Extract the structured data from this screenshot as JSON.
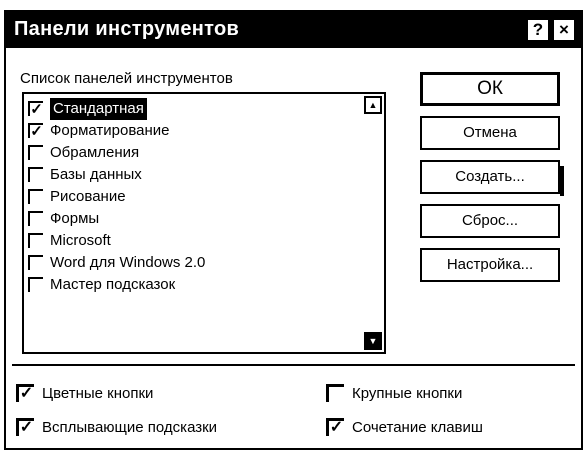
{
  "dialog": {
    "title": "Панели инструментов",
    "help_glyph": "?",
    "close_glyph": "×"
  },
  "toolbars": {
    "label": "Список панелей инструментов",
    "items": [
      {
        "label": "Стандартная",
        "checked": true
      },
      {
        "label": "Форматирование",
        "checked": true
      },
      {
        "label": "Обрамления",
        "checked": false
      },
      {
        "label": "Базы данных",
        "checked": false
      },
      {
        "label": "Рисование",
        "checked": false
      },
      {
        "label": "Формы",
        "checked": false
      },
      {
        "label": "Microsoft",
        "checked": false
      },
      {
        "label": "Word для Windows 2.0",
        "checked": false
      },
      {
        "label": "Мастер подсказок",
        "checked": false
      }
    ]
  },
  "buttons": {
    "ok": "ОК",
    "cancel": "Отмена",
    "create": "Создать...",
    "reset": "Сброс...",
    "settings": "Настройка..."
  },
  "options": {
    "color_buttons": {
      "label": "Цветные кнопки",
      "checked": true
    },
    "large_buttons": {
      "label": "Крупные кнопки",
      "checked": false
    },
    "tooltips": {
      "label": "Всплывающие подсказки",
      "checked": true
    },
    "shortcuts": {
      "label": "Сочетание клавиш",
      "checked": true
    }
  },
  "glyphs": {
    "check": "✓",
    "up": "▲",
    "down": "▼"
  }
}
